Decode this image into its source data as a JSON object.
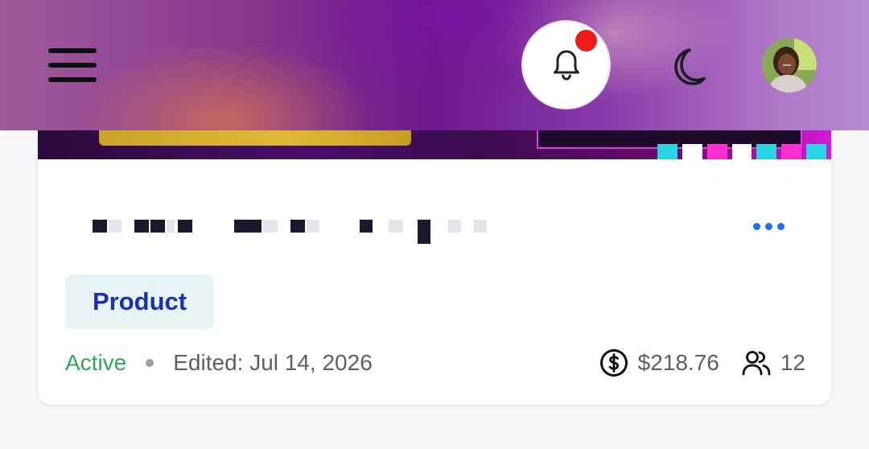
{
  "topbar": {
    "menu_icon": "hamburger-menu-icon",
    "notification_icon": "bell-icon",
    "notification_has_unread": true,
    "theme_icon": "moon-icon",
    "avatar_icon": "user-avatar"
  },
  "card": {
    "more_icon": "more-horizontal-icon",
    "tag": "Product",
    "status": "Active",
    "edited": "Edited: Jul 14, 2026",
    "amount": "$218.76",
    "members": "12",
    "amount_icon": "dollar-circle-icon",
    "members_icon": "users-icon"
  },
  "colors": {
    "accent_blue": "#1f6fe8",
    "tag_text": "#1c2fb0",
    "tag_bg": "#e7f4f3",
    "status_green": "#2fa84f",
    "notification_red": "#f01a1a"
  }
}
